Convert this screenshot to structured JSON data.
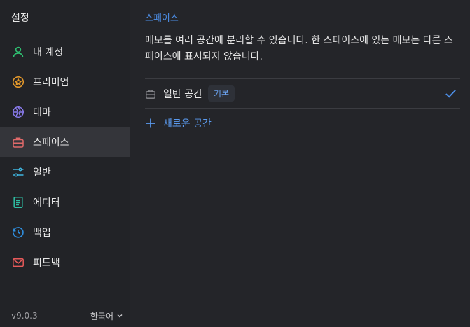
{
  "sidebar": {
    "title": "설정",
    "items": [
      {
        "label": "내 계정",
        "icon": "user-icon",
        "color": "#2fbf71"
      },
      {
        "label": "프리미엄",
        "icon": "star-badge-icon",
        "color": "#e79a2b"
      },
      {
        "label": "테마",
        "icon": "aperture-icon",
        "color": "#8b7cf0"
      },
      {
        "label": "스페이스",
        "icon": "briefcase-icon",
        "color": "#e06a6a"
      },
      {
        "label": "일반",
        "icon": "sliders-icon",
        "color": "#3fb6e0"
      },
      {
        "label": "에디터",
        "icon": "document-icon",
        "color": "#2fc0a4"
      },
      {
        "label": "백업",
        "icon": "history-icon",
        "color": "#2f8fe0"
      },
      {
        "label": "피드백",
        "icon": "mail-icon",
        "color": "#e85a5a"
      }
    ],
    "active_index": 3,
    "version": "v9.0.3",
    "language": "한국어"
  },
  "main": {
    "title": "스페이스",
    "description": "메모를 여러 공간에 분리할 수 있습니다. 한 스페이스에 있는 메모는 다른 스페이스에 표시되지 않습니다.",
    "spaces": [
      {
        "name": "일반 공간",
        "badge": "기본",
        "selected": true
      }
    ],
    "add_label": "새로운 공간"
  },
  "colors": {
    "accent": "#4d8fe8",
    "background": "#242529",
    "sidebar_active": "#34353a"
  }
}
